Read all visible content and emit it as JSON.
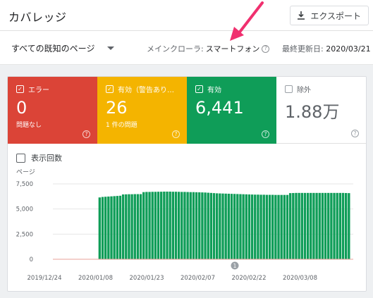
{
  "header": {
    "title": "カバレッジ",
    "export_label": "エクスポート",
    "export_icon": "download-icon"
  },
  "toolbar": {
    "filter_label": "すべての既知のページ",
    "crawler_label": "メインクローラ:",
    "crawler_value": "スマートフォン",
    "updated_label": "最終更新日:",
    "updated_value": "2020/03/21"
  },
  "tiles": [
    {
      "label": "エラー",
      "value": "0",
      "sub": "問題なし",
      "checked": true,
      "color": "#db4437"
    },
    {
      "label": "有効（警告あり…",
      "value": "26",
      "sub": "1 件の問題",
      "checked": true,
      "color": "#f4b400"
    },
    {
      "label": "有効",
      "value": "6,441",
      "sub": "",
      "checked": true,
      "color": "#0f9d58"
    },
    {
      "label": "除外",
      "value": "1.88万",
      "sub": "",
      "checked": false,
      "color": "#ffffff"
    }
  ],
  "impressions_label": "表示回数",
  "chart_data": {
    "type": "bar",
    "ylabel": "ページ",
    "yticks": [
      "7,500",
      "5,000",
      "2,500",
      "0"
    ],
    "ylim": [
      0,
      7500
    ],
    "xticks": [
      "2019/12/24",
      "2020/01/08",
      "2020/01/23",
      "2020/02/07",
      "2020/02/22",
      "2020/03/08"
    ],
    "annotation": "1",
    "series_color": "#0f9d58",
    "values": [
      0,
      0,
      0,
      0,
      0,
      0,
      0,
      0,
      0,
      0,
      0,
      0,
      0,
      0,
      0,
      6150,
      6200,
      6220,
      6240,
      6260,
      6280,
      6300,
      6320,
      6450,
      6460,
      6470,
      6470,
      6480,
      6480,
      6480,
      6680,
      6700,
      6700,
      6710,
      6710,
      6720,
      6720,
      6730,
      6730,
      6730,
      6720,
      6720,
      6710,
      6700,
      6700,
      6690,
      6680,
      6680,
      6670,
      6660,
      6650,
      6640,
      6620,
      6600,
      6580,
      6560,
      6550,
      6540,
      6530,
      6520,
      6510,
      6500,
      6490,
      6480,
      6470,
      6460,
      6450,
      6440,
      6430,
      6430,
      6420,
      6420,
      6410,
      6410,
      6410,
      6400,
      6400,
      6400,
      6400,
      6400,
      6580,
      6590,
      6600,
      6600,
      6600,
      6600,
      6600,
      6600,
      6600,
      6600,
      6600,
      6600,
      6600,
      6600,
      6600,
      6600,
      6600,
      6600,
      6600,
      6590,
      6580
    ]
  }
}
